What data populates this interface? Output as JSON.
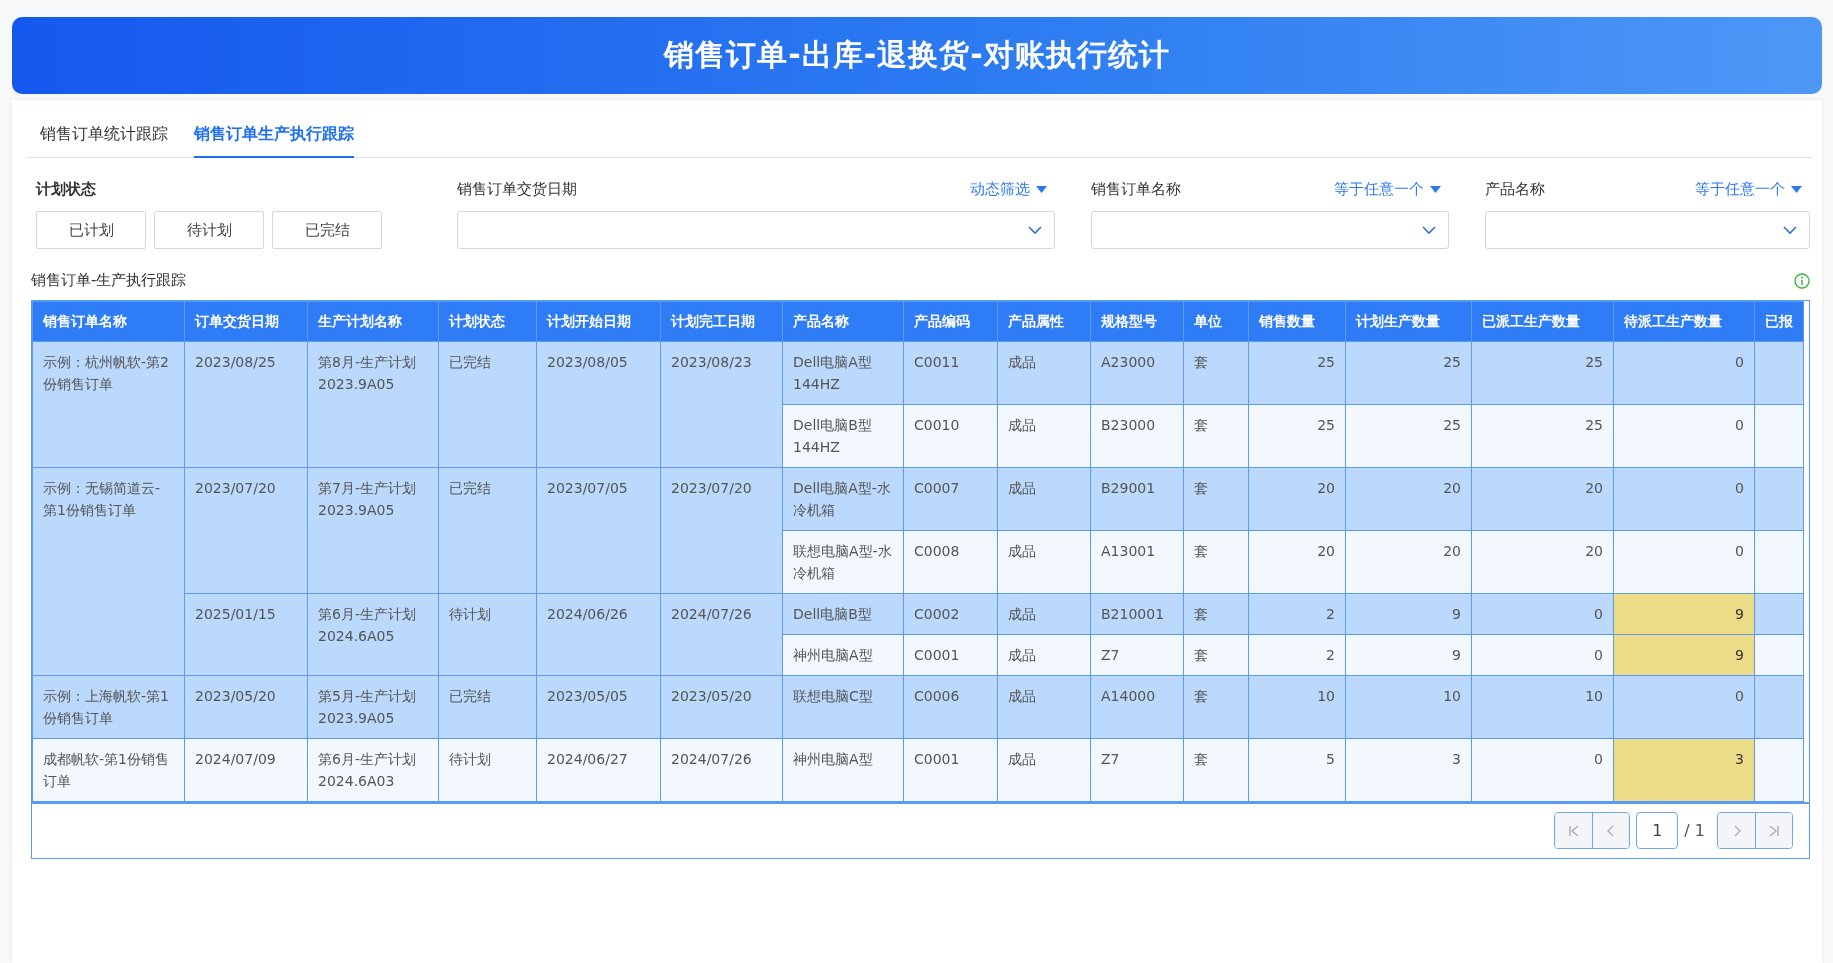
{
  "banner": {
    "title": "销售订单-出库-退换货-对账执行统计"
  },
  "tabs": [
    {
      "label": "销售订单统计跟踪",
      "selected": false
    },
    {
      "label": "销售订单生产执行跟踪",
      "selected": true
    }
  ],
  "filters": {
    "plan_status": {
      "label": "计划状态",
      "options": [
        {
          "label": "已计划",
          "selected": false
        },
        {
          "label": "待计划",
          "selected": false
        },
        {
          "label": "已完结",
          "selected": false
        }
      ]
    },
    "fields": [
      {
        "label": "销售订单交货日期",
        "mode": "动态筛选"
      },
      {
        "label": "销售订单名称",
        "mode": "等于任意一个"
      },
      {
        "label": "产品名称",
        "mode": "等于任意一个"
      }
    ]
  },
  "table": {
    "title": "销售订单-生产执行跟踪",
    "columns": [
      "销售订单名称",
      "订单交货日期",
      "生产计划名称",
      "计划状态",
      "计划开始日期",
      "计划完工日期",
      "产品名称",
      "产品编码",
      "产品属性",
      "规格型号",
      "单位",
      "销售数量",
      "计划生产数量",
      "已派工生产数量",
      "待派工生产数量",
      "已报"
    ],
    "orders": [
      {
        "name": "示例：杭州帆软-第2份销售订单",
        "plans": [
          {
            "delivery_date": "2023/08/25",
            "plan_name": "第8月-生产计划2023.9A05",
            "plan_status": "已完结",
            "start_date": "2023/08/05",
            "end_date": "2023/08/23",
            "products": [
              {
                "name": "Dell电脑A型144HZ",
                "code": "C0011",
                "attribute": "成品",
                "spec": "A23000",
                "unit": "套",
                "sales_qty": "25",
                "plan_qty": "25",
                "dispatched_qty": "25",
                "pending_qty": "0",
                "highlighted": false
              },
              {
                "name": "Dell电脑B型144HZ",
                "code": "C0010",
                "attribute": "成品",
                "spec": "B23000",
                "unit": "套",
                "sales_qty": "25",
                "plan_qty": "25",
                "dispatched_qty": "25",
                "pending_qty": "0",
                "highlighted": false
              }
            ]
          }
        ]
      },
      {
        "name": "示例：无锡简道云-第1份销售订单",
        "plans": [
          {
            "delivery_date": "2023/07/20",
            "plan_name": "第7月-生产计划2023.9A05",
            "plan_status": "已完结",
            "start_date": "2023/07/05",
            "end_date": "2023/07/20",
            "products": [
              {
                "name": "Dell电脑A型-水冷机箱",
                "code": "C0007",
                "attribute": "成品",
                "spec": "B29001",
                "unit": "套",
                "sales_qty": "20",
                "plan_qty": "20",
                "dispatched_qty": "20",
                "pending_qty": "0",
                "highlighted": false
              },
              {
                "name": "联想电脑A型-水冷机箱",
                "code": "C0008",
                "attribute": "成品",
                "spec": "A13001",
                "unit": "套",
                "sales_qty": "20",
                "plan_qty": "20",
                "dispatched_qty": "20",
                "pending_qty": "0",
                "highlighted": false
              }
            ]
          },
          {
            "delivery_date": "2025/01/15",
            "plan_name": "第6月-生产计划2024.6A05",
            "plan_status": "待计划",
            "start_date": "2024/06/26",
            "end_date": "2024/07/26",
            "products": [
              {
                "name": "Dell电脑B型",
                "code": "C0002",
                "attribute": "成品",
                "spec": "B210001",
                "unit": "套",
                "sales_qty": "2",
                "plan_qty": "9",
                "dispatched_qty": "0",
                "pending_qty": "9",
                "highlighted": true
              },
              {
                "name": "神州电脑A型",
                "code": "C0001",
                "attribute": "成品",
                "spec": "Z7",
                "unit": "套",
                "sales_qty": "2",
                "plan_qty": "9",
                "dispatched_qty": "0",
                "pending_qty": "9",
                "highlighted": true
              }
            ]
          }
        ]
      },
      {
        "name": "示例：上海帆软-第1份销售订单",
        "plans": [
          {
            "delivery_date": "2023/05/20",
            "plan_name": "第5月-生产计划2023.9A05",
            "plan_status": "已完结",
            "start_date": "2023/05/05",
            "end_date": "2023/05/20",
            "products": [
              {
                "name": "联想电脑C型",
                "code": "C0006",
                "attribute": "成品",
                "spec": "A14000",
                "unit": "套",
                "sales_qty": "10",
                "plan_qty": "10",
                "dispatched_qty": "10",
                "pending_qty": "0",
                "highlighted": false
              }
            ]
          }
        ]
      },
      {
        "name": "成都帆软-第1份销售订单",
        "plans": [
          {
            "delivery_date": "2024/07/09",
            "plan_name": "第6月-生产计划2024.6A03",
            "plan_status": "待计划",
            "start_date": "2024/06/27",
            "end_date": "2024/07/26",
            "products": [
              {
                "name": "神州电脑A型",
                "code": "C0001",
                "attribute": "成品",
                "spec": "Z7",
                "unit": "套",
                "sales_qty": "5",
                "plan_qty": "3",
                "dispatched_qty": "0",
                "pending_qty": "3",
                "highlighted": true
              }
            ]
          }
        ]
      }
    ]
  },
  "pager": {
    "page": "1",
    "total": "/ 1"
  }
}
